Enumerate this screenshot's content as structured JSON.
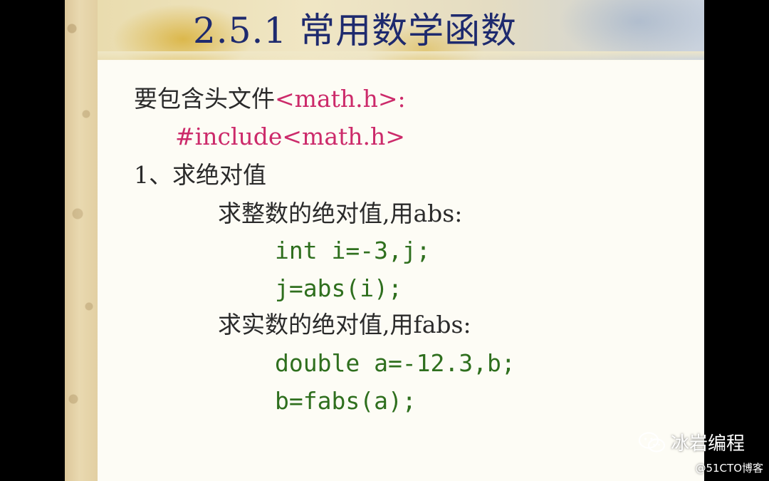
{
  "slide": {
    "title": "2.5.1 常用数学函数",
    "header_line_text": "要包含头文件",
    "header_line_file": "<math.h>:",
    "include_line": "#include<math.h>",
    "section_heading": "1、求绝对值",
    "int_subheading": "求整数的绝对值,用abs:",
    "int_code": [
      "int i=-3,j;",
      "j=abs(i);"
    ],
    "float_subheading": "求实数的绝对值,用fabs:",
    "float_code": [
      "double a=-12.3,b;",
      "b=fabs(a);"
    ]
  },
  "watermark": {
    "icon": "wechat-icon",
    "account": "冰岩编程",
    "source": "@51CTO博客"
  },
  "colors": {
    "title": "#1e2a6e",
    "body_text": "#2a2a2a",
    "include_pink": "#cc2a6a",
    "code_green": "#2f6f1e"
  }
}
